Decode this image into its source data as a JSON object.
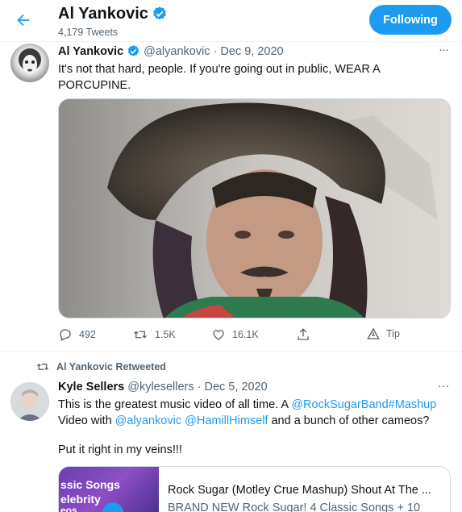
{
  "header": {
    "title": "Al Yankovic",
    "tweet_count": "4,179 Tweets",
    "follow_label": "Following"
  },
  "tweet1": {
    "name": "Al Yankovic",
    "handle": "@alyankovic",
    "separator": "·",
    "date": "Dec 9, 2020",
    "more": "···",
    "text_line1": "It's not that hard, people. If you're going out in public, WEAR A",
    "text_line2": "PORCUPINE.",
    "replies": "492",
    "retweets": "1.5K",
    "likes": "16.1K",
    "tip_label": "Tip"
  },
  "tweet2": {
    "retweeted_by": "Al Yankovic Retweeted",
    "name": "Kyle Sellers",
    "handle": "@kylesellers",
    "separator": "·",
    "date": "Dec 5, 2020",
    "more": "···",
    "text_a": "This is the greatest music video of all time. A ",
    "mention_a": "@RockSugarBand",
    "hashtag": "#Mashup",
    "text_b": "Video with ",
    "mention_b": "@alyankovic",
    "mention_c": "@HamillHimself",
    "text_c": " and a bunch of other cameos?",
    "text_d": "Put it right in my veins!!!",
    "card": {
      "thumb_line1": "ssic Songs",
      "thumb_line2": "elebrity",
      "thumb_line3": "eos",
      "title": "Rock Sugar (Motley Crue Mashup) Shout At The ...",
      "description": "BRAND NEW Rock Sugar! 4 Classic Songs + 10"
    }
  },
  "colors": {
    "accent": "#1d9bf0",
    "text": "#0f1419",
    "muted": "#536471",
    "border": "#eff3f4"
  }
}
